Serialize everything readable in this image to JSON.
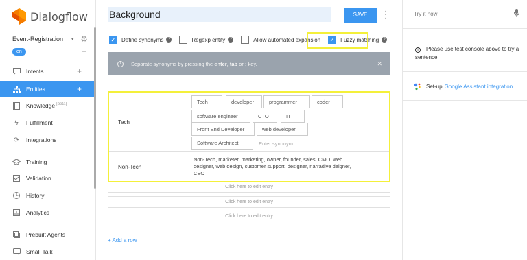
{
  "brand": {
    "name": "Dialogflow"
  },
  "agent": {
    "name": "Event-Registration",
    "language": "en"
  },
  "nav": [
    {
      "label": "Intents",
      "icon": "chat-icon",
      "plus": true,
      "beta": ""
    },
    {
      "label": "Entities",
      "icon": "entities-icon",
      "plus": true,
      "active": true,
      "beta": ""
    },
    {
      "label": "Knowledge",
      "icon": "book-icon",
      "plus": false,
      "beta": "[beta]"
    },
    {
      "label": "Fulfillment",
      "icon": "bolt-icon",
      "plus": false,
      "beta": ""
    },
    {
      "label": "Integrations",
      "icon": "integrations-icon",
      "plus": false,
      "beta": ""
    },
    {
      "label": "Training",
      "icon": "graduation-cap-icon",
      "plus": false,
      "beta": ""
    },
    {
      "label": "Validation",
      "icon": "check-square-icon",
      "plus": false,
      "beta": ""
    },
    {
      "label": "History",
      "icon": "clock-icon",
      "plus": false,
      "beta": ""
    },
    {
      "label": "Analytics",
      "icon": "bar-chart-icon",
      "plus": false,
      "beta": ""
    },
    {
      "label": "Prebuilt Agents",
      "icon": "prebuilt-icon",
      "plus": false,
      "beta": ""
    },
    {
      "label": "Small Talk",
      "icon": "speech-icon",
      "plus": false,
      "beta": ""
    }
  ],
  "entity": {
    "name": "Background"
  },
  "toolbar": {
    "save_label": "SAVE"
  },
  "options": {
    "define_synonyms": {
      "label": "Define synonyms",
      "checked": true
    },
    "regexp_entity": {
      "label": "Regexp entity",
      "checked": false
    },
    "automated_expansion": {
      "label": "Allow automated expansion",
      "checked": false
    },
    "fuzzy_matching": {
      "label": "Fuzzy matching",
      "checked": true
    }
  },
  "banner": {
    "prefix": "Separate synonyms by pressing the ",
    "enter": "enter",
    "mid1": ", ",
    "tab": "tab",
    "mid2": " or ",
    "semicolon": ";",
    "suffix": " key."
  },
  "entries": [
    {
      "value": "Tech",
      "synonyms": [
        "Tech",
        "developer",
        "programmer",
        "coder",
        "software engineer",
        "CTO",
        "IT",
        "Front End Developer",
        "web developer",
        "Software Architect"
      ],
      "placeholder": "Enter synonym"
    },
    {
      "value": "Non-Tech",
      "text": "Non-Tech, marketer, marketing, owner, founder, sales, CMO, web designer, web design, customer support, designer, narradive deigner, CEO"
    }
  ],
  "empty_rows": [
    "Click here to edit entry",
    "Click here to edit entry",
    "Click here to edit entry"
  ],
  "add_row": "+ Add a row",
  "right": {
    "try_label": "Try it now",
    "tip": "Please use test console above to try a sentence.",
    "ga_prefix": "Set-up",
    "ga_link": "Google Assistant integration"
  },
  "colors": {
    "accent": "#3b96f0",
    "highlight": "#f4f03a",
    "banner": "#9aa3ad"
  }
}
